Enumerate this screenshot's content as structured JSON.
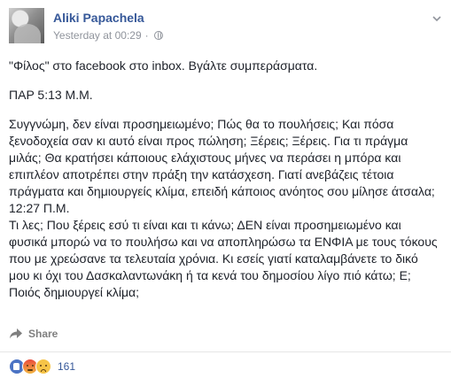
{
  "post": {
    "author": "Aliki Papachela",
    "timestamp": "Yesterday at 00:29",
    "separator": "·",
    "paragraphs": [
      "\"Φίλος\" στο facebook στο inbox. Βγάλτε συμπεράσματα.",
      "ΠΑΡ 5:13 Μ.Μ.",
      "Συγγνώμη, δεν είναι προσημειωμένο; Πώς θα το πουλήσεις; Και πόσα ξενοδοχεία σαν κι αυτό είναι προς πώληση; Ξέρεις; Ξέρεις. Για τι πράγμα μιλάς; Θα κρατήσει κάποιους ελάχιστους μήνες να περάσει η μπόρα και επιπλέον αποτρέπει στην πράξη την κατάσχεση. Γιατί ανεβάζεις τέτοια πράγματα και δημιουργείς κλίμα, επειδή κάποιος ανόητος σου μίλησε άτσαλα;",
      "12:27 Π.Μ.",
      "Τι λες; Που ξέρεις εσύ τι είναι και τι κάνω; ΔΕΝ είναι προσημειωμένο και φυσικά μπορώ να το πουλήσω και να αποπληρώσω τα ΕΝΦΙΑ με τους τόκους που με χρεώσανε τα τελευταία χρόνια. Κι εσείς γιατί καταλαμβάνετε το δικό μου κι όχι του Δασκαλαντωνάκη ή τα κενά του δημοσίου λίγο πιό κάτω; Ε; Ποιός δημιουργεί κλίμα;"
    ]
  },
  "actions": {
    "share_label": "Share"
  },
  "reactions": {
    "count": "161",
    "icons": [
      "like-icon",
      "angry-icon",
      "sad-icon"
    ]
  },
  "colors": {
    "link": "#365899",
    "meta": "#90949c",
    "text": "#1d2129"
  }
}
